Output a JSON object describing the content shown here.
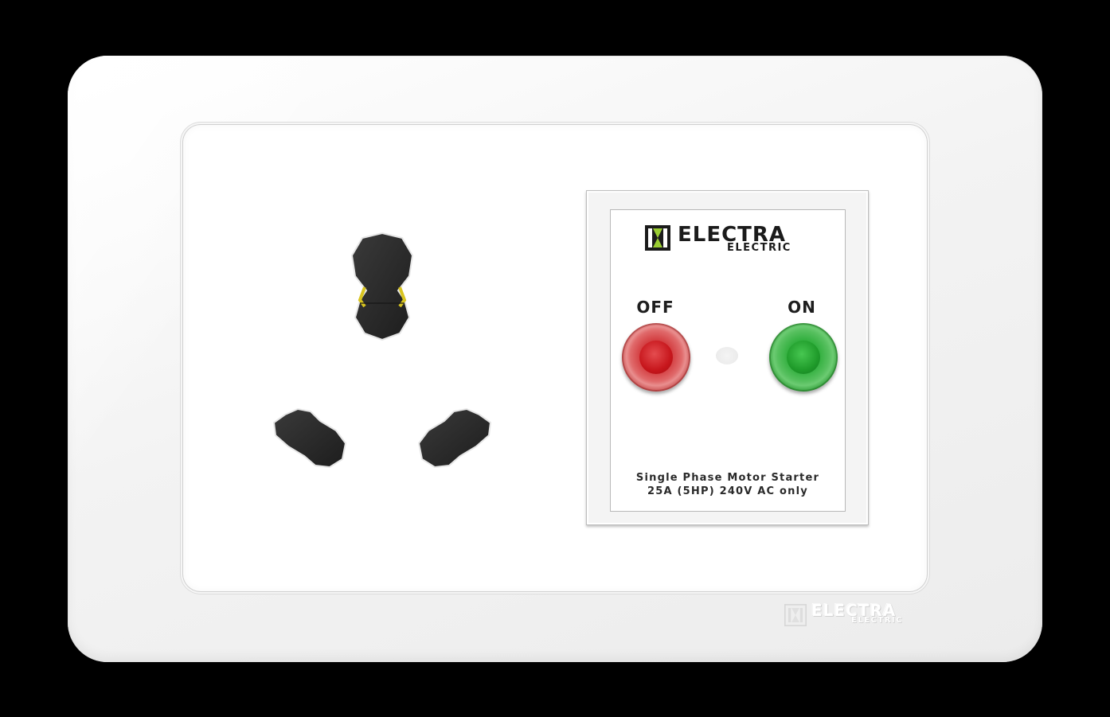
{
  "brand": {
    "name": "ELECTRA",
    "sub": "ELECTRIC"
  },
  "starter": {
    "off_label": "OFF",
    "on_label": "ON",
    "rating_line1": "Single Phase Motor Starter",
    "rating_line2": "25A (5HP) 240V AC only"
  },
  "watermark": {
    "name": "ELECTRA",
    "sub": "ELECTRIC"
  },
  "colors": {
    "off_button": "#c91a1f",
    "on_button": "#1f9b2a",
    "brand_accent": "#9acd32",
    "plate": "#f4f4f4",
    "background": "#000000"
  }
}
